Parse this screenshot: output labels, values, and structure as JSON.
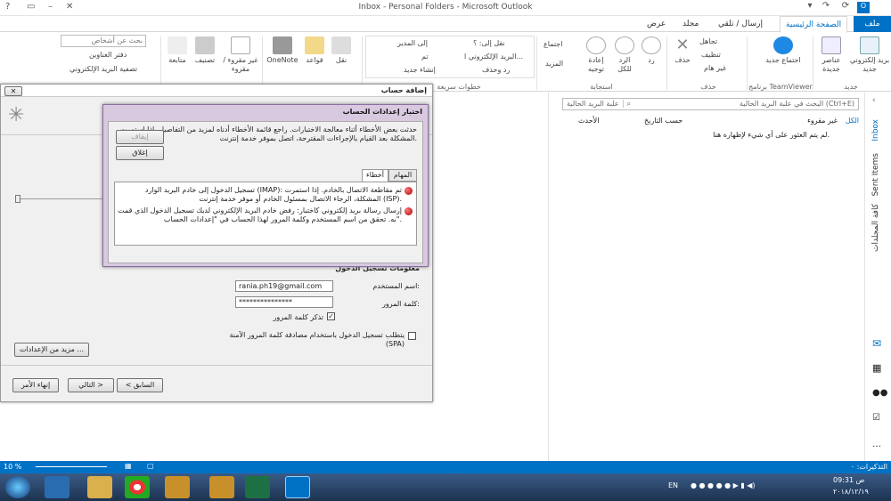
{
  "window": {
    "title": "Inbox - Personal Folders - Microsoft Outlook",
    "help": "?"
  },
  "tabs": [
    {
      "label": "ملف"
    },
    {
      "label": "الصفحة الرئيسية"
    },
    {
      "label": "إرسال / تلقي"
    },
    {
      "label": "مجلد"
    },
    {
      "label": "عرض"
    }
  ],
  "ribbon": {
    "new_email": "بريد إلكتروني جديد",
    "new_items": "عناصر جديدة",
    "new_group_label": "جديد",
    "teamviewer_meeting": "اجتماع جديد",
    "teamviewer_label": "برنامج TeamViewer",
    "ignore": "تجاهل",
    "cleanup": "تنظيف",
    "junk": "غير هام",
    "delete": "حذف",
    "delete_group": "حذف",
    "reply": "رد",
    "reply_all": "الرد للكل",
    "forward": "إعادة توجيه",
    "meeting": "اجتماع",
    "more": "المزيد",
    "respond_group": "استجابة",
    "qs_move": "نقل إلى: ؟",
    "qs_team": "البريد الإلكتروني ا...",
    "qs_reply_delete": "رد وحذف",
    "qs_manager": "إلى المدير",
    "qs_done": "تم",
    "qs_new": "إنشاء جديد",
    "qs_group": "خطوات سريعة",
    "move": "نقل",
    "rules": "قواعد",
    "onenote": "OneNote",
    "unread": "غير مقروء / مقروء",
    "categorize": "تصنيف",
    "followup": "متابعة",
    "search_people": "بحث عن أشخاص",
    "address_book": "دفتر العناوين",
    "filter_email": "تصفية البريد الإلكتروني"
  },
  "mail": {
    "search_placeholder": "البحث في علبة البريد الحالية (Ctrl+E)",
    "search_scope": "علبة البريد الحالية",
    "filter_all": "الكل",
    "filter_unread": "غير مقروء",
    "sort_by": "حسب التاريخ",
    "sort_order": "الأحدث",
    "empty": "لم يتم العثور على أي شيء لإظهاره هنا."
  },
  "navrail": {
    "inbox": "Inbox",
    "sent": "Sent Items",
    "all_folders": "كافة المجلدات"
  },
  "status": {
    "zoom": "10 %",
    "reminders": "التذكيرات: ٠"
  },
  "add_account": {
    "title": "إضافة حساب",
    "logon_header": "معلومات تسجيل الدخول",
    "username_label": "اسم المستخدم:",
    "username_value": "rania.ph19@gmail.com",
    "password_label": "كلمة المرور:",
    "password_value": "***************",
    "remember_label": "تذكر كلمة المرور",
    "spa_label": "يتطلب تسجيل الدخول باستخدام مصادقة كلمة المرور الآمنة (SPA)",
    "more_settings": "مزيد من الإعدادات ...",
    "back": "< السابق",
    "next": "التالي >",
    "finish": "إنهاء الأمر"
  },
  "test_dialog": {
    "title": "اختبار إعدادات الحساب",
    "message": "حدثت بعض الأخطاء أثناء معالجة الاختبارات. راجع قائمة الأخطاء أدناه لمزيد من التفاصيل. إذا استمرت المشكلة بعد القيام بالإجراءات المقترحة، اتصل بموفر خدمة إنترنت.",
    "stop": "إيقاف",
    "close": "إغلاق",
    "tab_tasks": "المهام",
    "tab_errors": "أخطاء",
    "errors": [
      "تسجيل الدخول إلى خادم البريد الوارد (IMAP): تم مقاطعة الاتصال بالخادم. إذا استمرت المشكلة، الرجاء الاتصال بمسئول الخادم أو موفر خدمة إنترنت (ISP).",
      "إرسال رسالة بريد إلكتروني كاختبار: رفض خادم البريد الإلكتروني لديك تسجيل الدخول الذي قمت به. تحقق من اسم المستخدم وكلمة المرور لهذا الحساب في \"إعدادات الحساب\"."
    ]
  },
  "taskbar": {
    "lang": "EN",
    "time": "09:31 ص",
    "date": "٢٠١٨/١٢/١٩"
  },
  "colors": {
    "accent": "#0072c6",
    "dialog": "#d8c8e0"
  }
}
